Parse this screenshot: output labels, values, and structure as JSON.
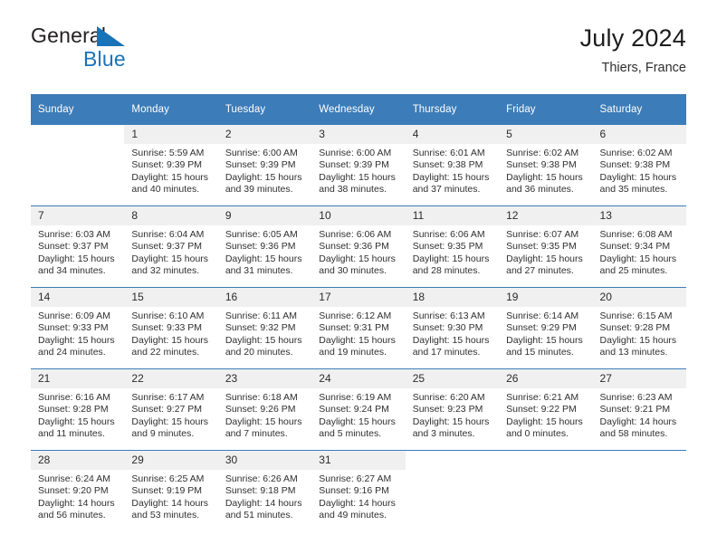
{
  "brand": {
    "word_one": "General",
    "word_two": "Blue",
    "triangle_icon": "blue-triangle-icon",
    "accent_color": "#1a73b7"
  },
  "header": {
    "title": "July 2024",
    "location": "Thiers, France",
    "header_bg_color": "#3c7cb8",
    "daynum_bg_color": "#f0f0f0"
  },
  "weekday_headers": [
    "Sunday",
    "Monday",
    "Tuesday",
    "Wednesday",
    "Thursday",
    "Friday",
    "Saturday"
  ],
  "labels": {
    "sunrise_prefix": "Sunrise:",
    "sunset_prefix": "Sunset:",
    "daylight_prefix": "Daylight:"
  },
  "weeks": [
    [
      {
        "day": "",
        "blank": true,
        "empty": true,
        "sunrise": "",
        "sunset": "",
        "daylight_line1": "",
        "daylight_line2": ""
      },
      {
        "day": "1",
        "sunrise": "Sunrise: 5:59 AM",
        "sunset": "Sunset: 9:39 PM",
        "daylight_line1": "Daylight: 15 hours",
        "daylight_line2": "and 40 minutes."
      },
      {
        "day": "2",
        "sunrise": "Sunrise: 6:00 AM",
        "sunset": "Sunset: 9:39 PM",
        "daylight_line1": "Daylight: 15 hours",
        "daylight_line2": "and 39 minutes."
      },
      {
        "day": "3",
        "sunrise": "Sunrise: 6:00 AM",
        "sunset": "Sunset: 9:39 PM",
        "daylight_line1": "Daylight: 15 hours",
        "daylight_line2": "and 38 minutes."
      },
      {
        "day": "4",
        "sunrise": "Sunrise: 6:01 AM",
        "sunset": "Sunset: 9:38 PM",
        "daylight_line1": "Daylight: 15 hours",
        "daylight_line2": "and 37 minutes."
      },
      {
        "day": "5",
        "sunrise": "Sunrise: 6:02 AM",
        "sunset": "Sunset: 9:38 PM",
        "daylight_line1": "Daylight: 15 hours",
        "daylight_line2": "and 36 minutes."
      },
      {
        "day": "6",
        "sunrise": "Sunrise: 6:02 AM",
        "sunset": "Sunset: 9:38 PM",
        "daylight_line1": "Daylight: 15 hours",
        "daylight_line2": "and 35 minutes."
      }
    ],
    [
      {
        "day": "7",
        "sunrise": "Sunrise: 6:03 AM",
        "sunset": "Sunset: 9:37 PM",
        "daylight_line1": "Daylight: 15 hours",
        "daylight_line2": "and 34 minutes."
      },
      {
        "day": "8",
        "sunrise": "Sunrise: 6:04 AM",
        "sunset": "Sunset: 9:37 PM",
        "daylight_line1": "Daylight: 15 hours",
        "daylight_line2": "and 32 minutes."
      },
      {
        "day": "9",
        "sunrise": "Sunrise: 6:05 AM",
        "sunset": "Sunset: 9:36 PM",
        "daylight_line1": "Daylight: 15 hours",
        "daylight_line2": "and 31 minutes."
      },
      {
        "day": "10",
        "sunrise": "Sunrise: 6:06 AM",
        "sunset": "Sunset: 9:36 PM",
        "daylight_line1": "Daylight: 15 hours",
        "daylight_line2": "and 30 minutes."
      },
      {
        "day": "11",
        "sunrise": "Sunrise: 6:06 AM",
        "sunset": "Sunset: 9:35 PM",
        "daylight_line1": "Daylight: 15 hours",
        "daylight_line2": "and 28 minutes."
      },
      {
        "day": "12",
        "sunrise": "Sunrise: 6:07 AM",
        "sunset": "Sunset: 9:35 PM",
        "daylight_line1": "Daylight: 15 hours",
        "daylight_line2": "and 27 minutes."
      },
      {
        "day": "13",
        "sunrise": "Sunrise: 6:08 AM",
        "sunset": "Sunset: 9:34 PM",
        "daylight_line1": "Daylight: 15 hours",
        "daylight_line2": "and 25 minutes."
      }
    ],
    [
      {
        "day": "14",
        "sunrise": "Sunrise: 6:09 AM",
        "sunset": "Sunset: 9:33 PM",
        "daylight_line1": "Daylight: 15 hours",
        "daylight_line2": "and 24 minutes."
      },
      {
        "day": "15",
        "sunrise": "Sunrise: 6:10 AM",
        "sunset": "Sunset: 9:33 PM",
        "daylight_line1": "Daylight: 15 hours",
        "daylight_line2": "and 22 minutes."
      },
      {
        "day": "16",
        "sunrise": "Sunrise: 6:11 AM",
        "sunset": "Sunset: 9:32 PM",
        "daylight_line1": "Daylight: 15 hours",
        "daylight_line2": "and 20 minutes."
      },
      {
        "day": "17",
        "sunrise": "Sunrise: 6:12 AM",
        "sunset": "Sunset: 9:31 PM",
        "daylight_line1": "Daylight: 15 hours",
        "daylight_line2": "and 19 minutes."
      },
      {
        "day": "18",
        "sunrise": "Sunrise: 6:13 AM",
        "sunset": "Sunset: 9:30 PM",
        "daylight_line1": "Daylight: 15 hours",
        "daylight_line2": "and 17 minutes."
      },
      {
        "day": "19",
        "sunrise": "Sunrise: 6:14 AM",
        "sunset": "Sunset: 9:29 PM",
        "daylight_line1": "Daylight: 15 hours",
        "daylight_line2": "and 15 minutes."
      },
      {
        "day": "20",
        "sunrise": "Sunrise: 6:15 AM",
        "sunset": "Sunset: 9:28 PM",
        "daylight_line1": "Daylight: 15 hours",
        "daylight_line2": "and 13 minutes."
      }
    ],
    [
      {
        "day": "21",
        "sunrise": "Sunrise: 6:16 AM",
        "sunset": "Sunset: 9:28 PM",
        "daylight_line1": "Daylight: 15 hours",
        "daylight_line2": "and 11 minutes."
      },
      {
        "day": "22",
        "sunrise": "Sunrise: 6:17 AM",
        "sunset": "Sunset: 9:27 PM",
        "daylight_line1": "Daylight: 15 hours",
        "daylight_line2": "and 9 minutes."
      },
      {
        "day": "23",
        "sunrise": "Sunrise: 6:18 AM",
        "sunset": "Sunset: 9:26 PM",
        "daylight_line1": "Daylight: 15 hours",
        "daylight_line2": "and 7 minutes."
      },
      {
        "day": "24",
        "sunrise": "Sunrise: 6:19 AM",
        "sunset": "Sunset: 9:24 PM",
        "daylight_line1": "Daylight: 15 hours",
        "daylight_line2": "and 5 minutes."
      },
      {
        "day": "25",
        "sunrise": "Sunrise: 6:20 AM",
        "sunset": "Sunset: 9:23 PM",
        "daylight_line1": "Daylight: 15 hours",
        "daylight_line2": "and 3 minutes."
      },
      {
        "day": "26",
        "sunrise": "Sunrise: 6:21 AM",
        "sunset": "Sunset: 9:22 PM",
        "daylight_line1": "Daylight: 15 hours",
        "daylight_line2": "and 0 minutes."
      },
      {
        "day": "27",
        "sunrise": "Sunrise: 6:23 AM",
        "sunset": "Sunset: 9:21 PM",
        "daylight_line1": "Daylight: 14 hours",
        "daylight_line2": "and 58 minutes."
      }
    ],
    [
      {
        "day": "28",
        "sunrise": "Sunrise: 6:24 AM",
        "sunset": "Sunset: 9:20 PM",
        "daylight_line1": "Daylight: 14 hours",
        "daylight_line2": "and 56 minutes."
      },
      {
        "day": "29",
        "sunrise": "Sunrise: 6:25 AM",
        "sunset": "Sunset: 9:19 PM",
        "daylight_line1": "Daylight: 14 hours",
        "daylight_line2": "and 53 minutes."
      },
      {
        "day": "30",
        "sunrise": "Sunrise: 6:26 AM",
        "sunset": "Sunset: 9:18 PM",
        "daylight_line1": "Daylight: 14 hours",
        "daylight_line2": "and 51 minutes."
      },
      {
        "day": "31",
        "sunrise": "Sunrise: 6:27 AM",
        "sunset": "Sunset: 9:16 PM",
        "daylight_line1": "Daylight: 14 hours",
        "daylight_line2": "and 49 minutes."
      },
      {
        "day": "",
        "blank": true,
        "empty": true,
        "sunrise": "",
        "sunset": "",
        "daylight_line1": "",
        "daylight_line2": ""
      },
      {
        "day": "",
        "blank": true,
        "empty": true,
        "sunrise": "",
        "sunset": "",
        "daylight_line1": "",
        "daylight_line2": ""
      },
      {
        "day": "",
        "blank": true,
        "empty": true,
        "sunrise": "",
        "sunset": "",
        "daylight_line1": "",
        "daylight_line2": ""
      }
    ]
  ]
}
